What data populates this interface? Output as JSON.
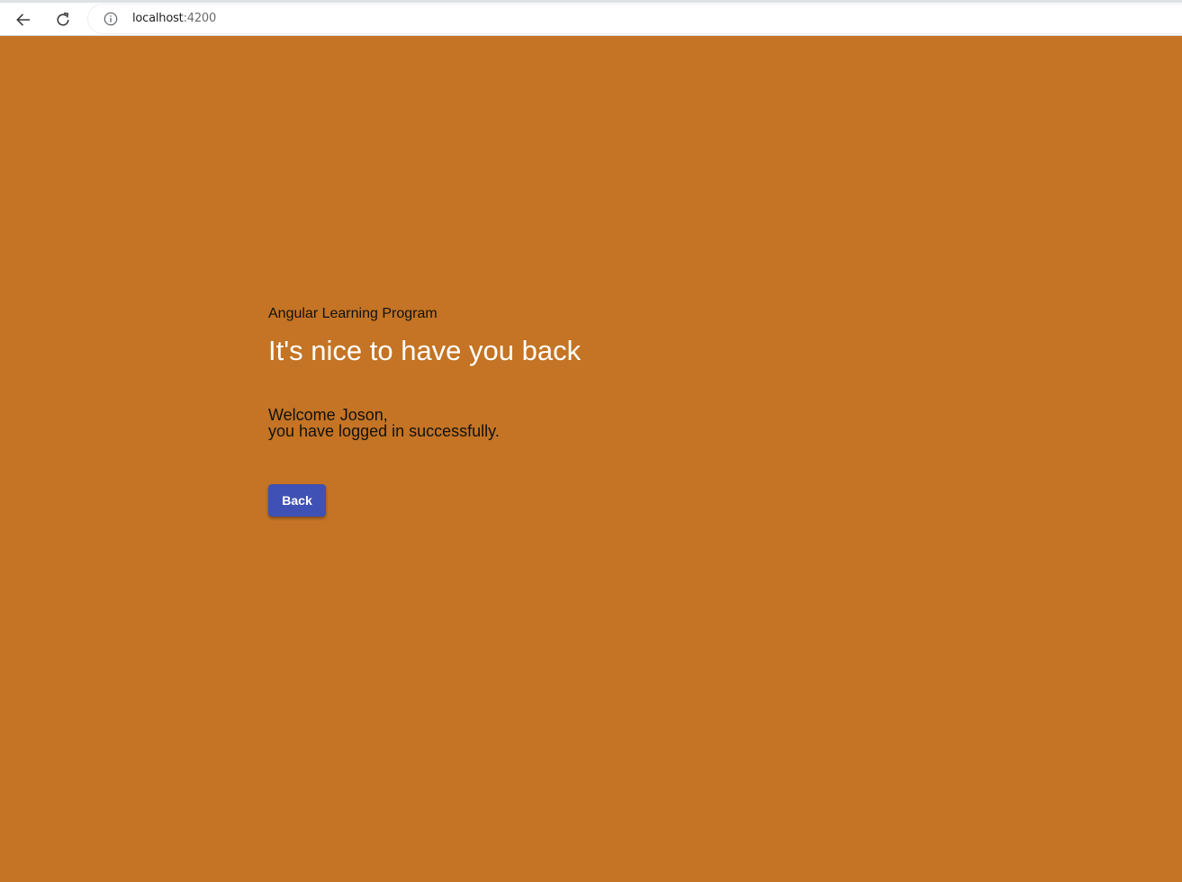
{
  "browser": {
    "url_host": "localhost",
    "url_port": ":4200",
    "icons": {
      "back": "arrow-left-icon",
      "reload": "reload-icon",
      "site_info": "info-icon"
    }
  },
  "page": {
    "background_color": "#c47424",
    "program_name": "Angular Learning Program",
    "heading": "It's nice to have you back",
    "welcome_line1": "Welcome Joson,",
    "welcome_line2": "you have logged in successfully.",
    "back_button_label": "Back",
    "button_color": "#3f51b5"
  }
}
